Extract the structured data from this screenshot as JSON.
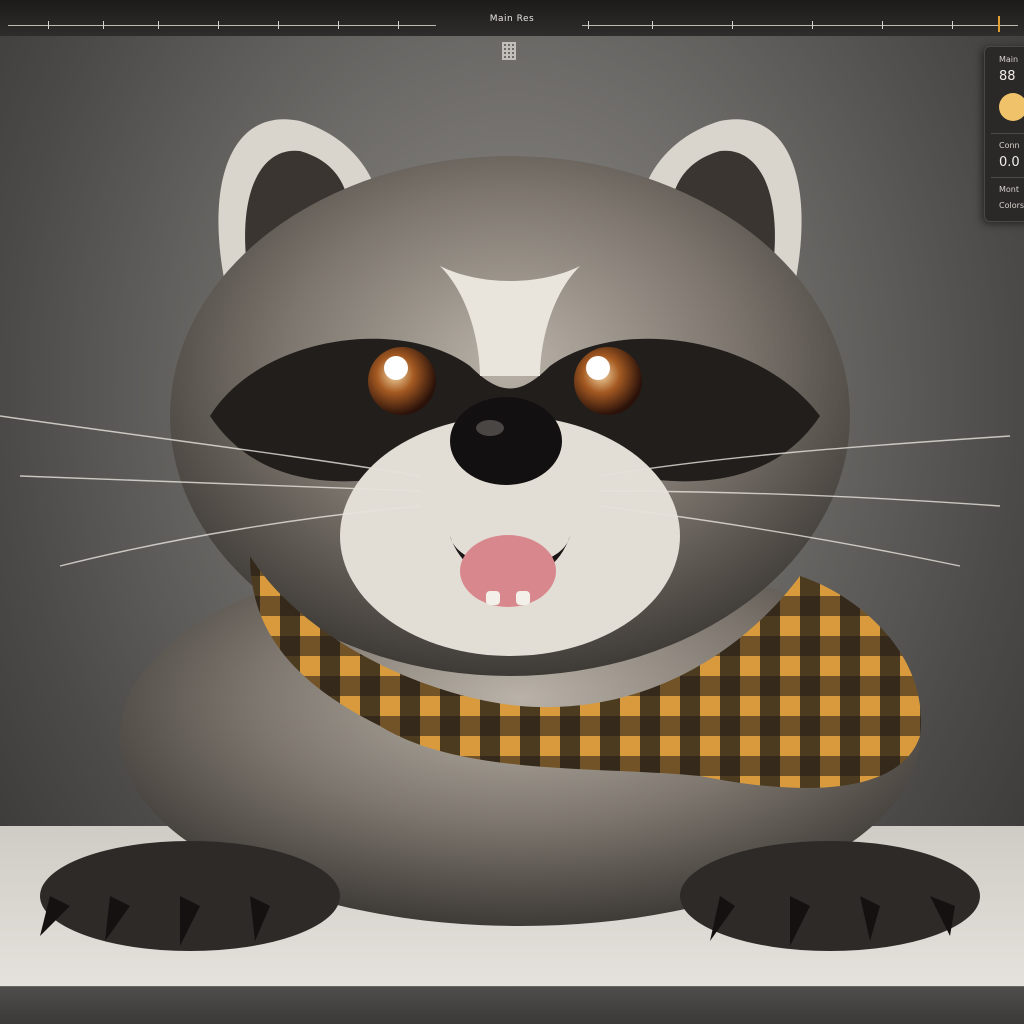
{
  "header": {
    "title": "Main Res"
  },
  "panel": {
    "label_1": "Main",
    "value_1": "88",
    "swatch_color": "#f0c26a",
    "label_2": "Conn",
    "value_2": "0.0",
    "label_3": "Mont",
    "label_4": "Colors"
  },
  "image": {
    "subject_color": "#6e6a66",
    "scarf_color_1": "#d89a3c",
    "scarf_color_2": "#1e1a16"
  }
}
